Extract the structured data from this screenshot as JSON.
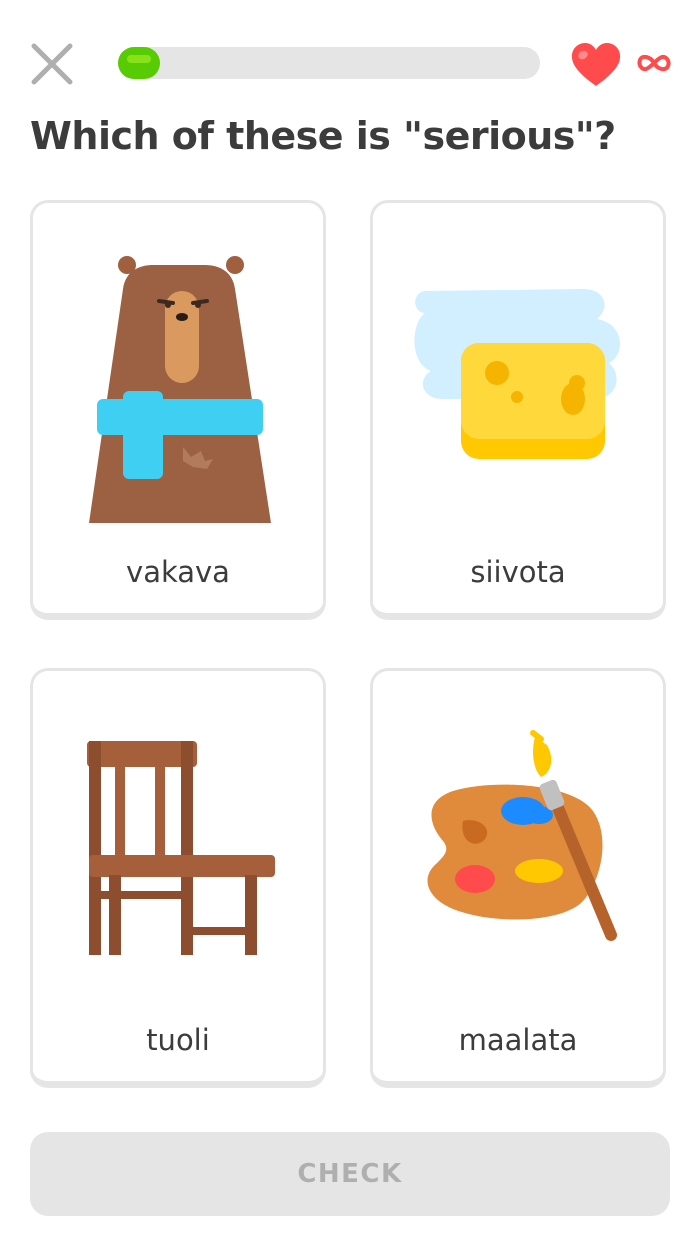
{
  "header": {
    "close_icon": "close-x-icon",
    "progress_fraction": 0.1,
    "hearts": {
      "icon": "heart-icon",
      "value": "∞",
      "value_icon": "infinity-icon"
    }
  },
  "prompt": "Which of these is \"serious\"?",
  "options": [
    {
      "label": "vakava",
      "icon": "bear-with-scarf-icon"
    },
    {
      "label": "siivota",
      "icon": "sponge-icon"
    },
    {
      "label": "tuoli",
      "icon": "chair-icon"
    },
    {
      "label": "maalata",
      "icon": "paint-palette-icon"
    }
  ],
  "footer": {
    "check_label": "CHECK"
  },
  "colors": {
    "progress": "#58cc02",
    "heart": "#ff4b4b",
    "border": "#e5e5e5",
    "disabled_button": "#e5e5e5",
    "disabled_text": "#afafaf"
  }
}
